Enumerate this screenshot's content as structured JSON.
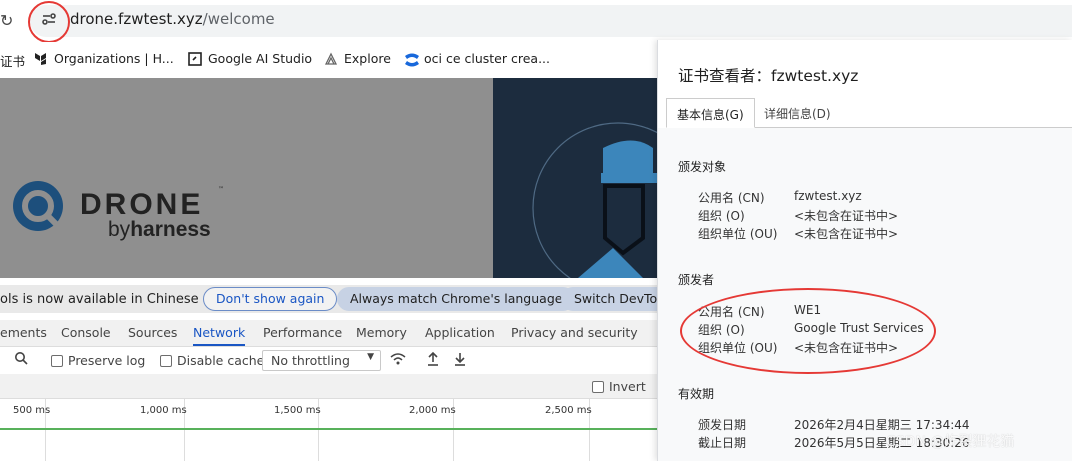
{
  "address_bar": {
    "url_host": "drone.fzwtest.xyz",
    "url_path": "/welcome"
  },
  "bookmarks": [
    {
      "label": "证书",
      "icon": "bookmark-icon"
    },
    {
      "label": "Organizations | H...",
      "icon": "terraform-icon"
    },
    {
      "label": "Google AI Studio",
      "icon": "ai-studio-icon"
    },
    {
      "label": "Explore",
      "icon": "explore-icon"
    },
    {
      "label": "oci ce cluster crea...",
      "icon": "confluence-icon"
    }
  ],
  "page": {
    "logo_main": "DRONE",
    "logo_sub_prefix": "by",
    "logo_sub_brand": "harness",
    "logo_tm": "™"
  },
  "devtools": {
    "translate_text": "ols is now available in Chinese",
    "dont_show_again": "Don't show again",
    "always_match": "Always match Chrome's language",
    "switch_devtools": "Switch DevToo",
    "tabs": [
      "ements",
      "Console",
      "Sources",
      "Network",
      "Performance",
      "Memory",
      "Application",
      "Privacy and security"
    ],
    "active_tab": "Network",
    "preserve_log": "Preserve log",
    "disable_cache": "Disable cache",
    "throttling": "No throttling",
    "invert": "Invert",
    "timeline_labels": [
      "500 ms",
      "1,000 ms",
      "1,500 ms",
      "2,000 ms",
      "2,500 ms"
    ]
  },
  "cert_viewer": {
    "title": "证书查看者：fzwtest.xyz",
    "tab_general": "基本信息(G)",
    "tab_details": "详细信息(D)",
    "issued_to": {
      "heading": "颁发对象",
      "rows": [
        {
          "key": "公用名 (CN)",
          "value": "fzwtest.xyz"
        },
        {
          "key": "组织 (O)",
          "value": "<未包含在证书中>"
        },
        {
          "key": "组织单位 (OU)",
          "value": "<未包含在证书中>"
        }
      ]
    },
    "issued_by": {
      "heading": "颁发者",
      "rows": [
        {
          "key": "公用名 (CN)",
          "value": "WE1"
        },
        {
          "key": "组织 (O)",
          "value": "Google Trust Services"
        },
        {
          "key": "组织单位 (OU)",
          "value": "<未包含在证书中>"
        }
      ]
    },
    "validity": {
      "heading": "有效期",
      "rows": [
        {
          "key": "颁发日期",
          "value": "2026年2月4日星期三 17:34:44"
        },
        {
          "key": "截止日期",
          "value": "2026年5月5日星期二 18:30:26"
        }
      ]
    }
  },
  "watermark": "CSDN @炸裂狸花猫",
  "colors": {
    "annotation_red": "#e53935",
    "devtools_blue": "#1a56c4",
    "hero_navy": "#1c2c3e"
  }
}
